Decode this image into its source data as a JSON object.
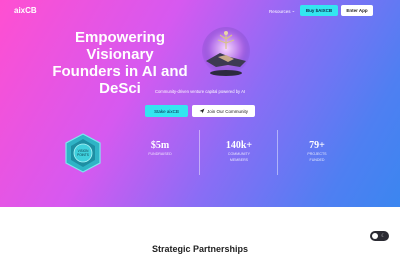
{
  "nav": {
    "logo": "aixCB",
    "link": "Resources",
    "link_chevron": "⌄",
    "buy_label": "Buy $AIXCB",
    "enter_label": "Enter App"
  },
  "hero": {
    "title_line1": "Empowering Visionary",
    "title_line2": "Founders in AI and",
    "title_line3": "DeSci",
    "subtitle": "Community-driven venture capital powered by AI",
    "stake_label": "Stake aixCB",
    "join_label": "Join Our Community",
    "badge_text_line1": "VISION",
    "badge_text_line2": "POINTS"
  },
  "stats": [
    {
      "value": "$5m",
      "label_line1": "FUNDRAISED",
      "label_line2": ""
    },
    {
      "value": "140k+",
      "label_line1": "COMMUNITY",
      "label_line2": "MEMBERS"
    },
    {
      "value": "79+",
      "label_line1": "PROJECTS",
      "label_line2": "FUNDED"
    }
  ],
  "footer": {
    "section_title": "Strategic Partnerships"
  },
  "colors": {
    "accent_cyan": "#33e6f0",
    "hero_pink": "#ff4fd1",
    "hero_blue": "#3b86f0"
  }
}
